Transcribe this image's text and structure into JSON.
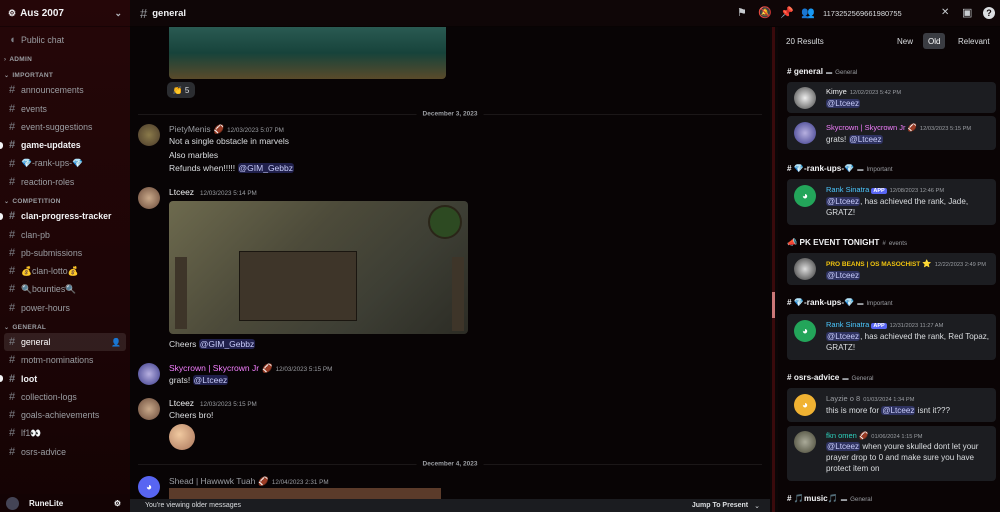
{
  "server": {
    "name": "Aus 2007"
  },
  "sidebar": {
    "public_chat": "Public chat",
    "cat_admin": "ADMIN",
    "cat_important": "IMPORTANT",
    "important": [
      "announcements",
      "events",
      "event-suggestions",
      "game-updates",
      "💎-rank-ups-💎",
      "reaction-roles"
    ],
    "cat_competition": "COMPETITION",
    "competition": [
      "clan-progress-tracker",
      "clan-pb",
      "pb-submissions",
      "💰clan-lotto💰",
      "🔍bounties🔍",
      "power-hours"
    ],
    "cat_general": "GENERAL",
    "general": [
      "general",
      "motm-nominations",
      "loot",
      "collection-logs",
      "goals-achievements",
      "lf1👀",
      "osrs-advice"
    ]
  },
  "userbar": {
    "name": "RuneLite"
  },
  "topbar": {
    "channel": "general",
    "search_query": "1173252569661980755"
  },
  "chat": {
    "reaction_count": "5",
    "date1": "December 3, 2023",
    "date2": "December 4, 2023",
    "m1": {
      "author": "PietyMenis",
      "ts": "12/03/2023 5:07 PM",
      "l1": "Not a single obstacle in marvels",
      "l2": "Also marbles",
      "l3": "Refunds when!!!!!",
      "mention": "@GIM_Gebbz"
    },
    "m2": {
      "author": "Ltceez",
      "ts": "12/03/2023 5:14 PM",
      "text": "Cheers ",
      "mention": "@GIM_Gebbz"
    },
    "m3": {
      "author": "Skycrown | Skycrown Jr",
      "ts": "12/03/2023 5:15 PM",
      "text": "grats! ",
      "mention": "@Ltceez"
    },
    "m4": {
      "author": "Ltceez",
      "ts": "12/03/2023 5:15 PM",
      "text": "Cheers bro!"
    },
    "m5": {
      "author": "Shead | Hawwwk Tuah",
      "ts": "12/04/2023 2:31 PM"
    },
    "older_bar": "You're viewing older messages",
    "jump": "Jump To Present"
  },
  "search": {
    "results": "20 Results",
    "sort": [
      "New",
      "Old",
      "Relevant"
    ],
    "groups": [
      {
        "channel": "general",
        "sub": "General"
      },
      {
        "channel": "💎-rank-ups-💎",
        "sub": "Important"
      },
      {
        "channel": "PK EVENT TONIGHT",
        "sub": "events"
      },
      {
        "channel": "💎-rank-ups-💎",
        "sub": "Important"
      },
      {
        "channel": "osrs-advice",
        "sub": "General"
      },
      {
        "channel": "🎵music🎵",
        "sub": "General"
      }
    ],
    "r1": {
      "author": "Kimye",
      "ts": "12/02/2023 5:42 PM",
      "mention": "@Ltceez"
    },
    "r2": {
      "author": "Skycrown | Skycrown Jr",
      "ts": "12/03/2023 5:15 PM",
      "text": "grats! ",
      "mention": "@Ltceez"
    },
    "r3": {
      "author": "Rank Sinatra",
      "badge": "APP",
      "ts": "12/08/2023 12:46 PM",
      "mention": "@Ltceez",
      "text": ", has achieved the rank, Jade, GRATZ!"
    },
    "r4": {
      "author": "PRO BEANS | OS MASOCHIST",
      "ts": "12/22/2023 2:49 PM",
      "mention": "@Ltceez"
    },
    "r5": {
      "author": "Rank Sinatra",
      "badge": "APP",
      "ts": "12/31/2023 11:27 AM",
      "mention": "@Ltceez",
      "text": ", has achieved the rank, Red Topaz, GRATZ!"
    },
    "r6": {
      "author": "Layzie o 8",
      "ts": "01/03/2024 1:34 PM",
      "text": "this is more for ",
      "mention": "@Ltceez",
      "text2": " isnt it???"
    },
    "r7": {
      "author": "fkn omen",
      "ts": "01/06/2024 1:15 PM",
      "mention": "@Ltceez",
      "text": " when youre skulled dont let your prayer drop to 0 and make sure you have protect item on"
    }
  },
  "colors": {
    "skycrown": "#f47fff",
    "rank_sinatra": "#4bc8ff",
    "pro_beans": "#f1c40f",
    "fkn_omen": "#2dd4bf",
    "layzie": "#9b9ea3"
  }
}
